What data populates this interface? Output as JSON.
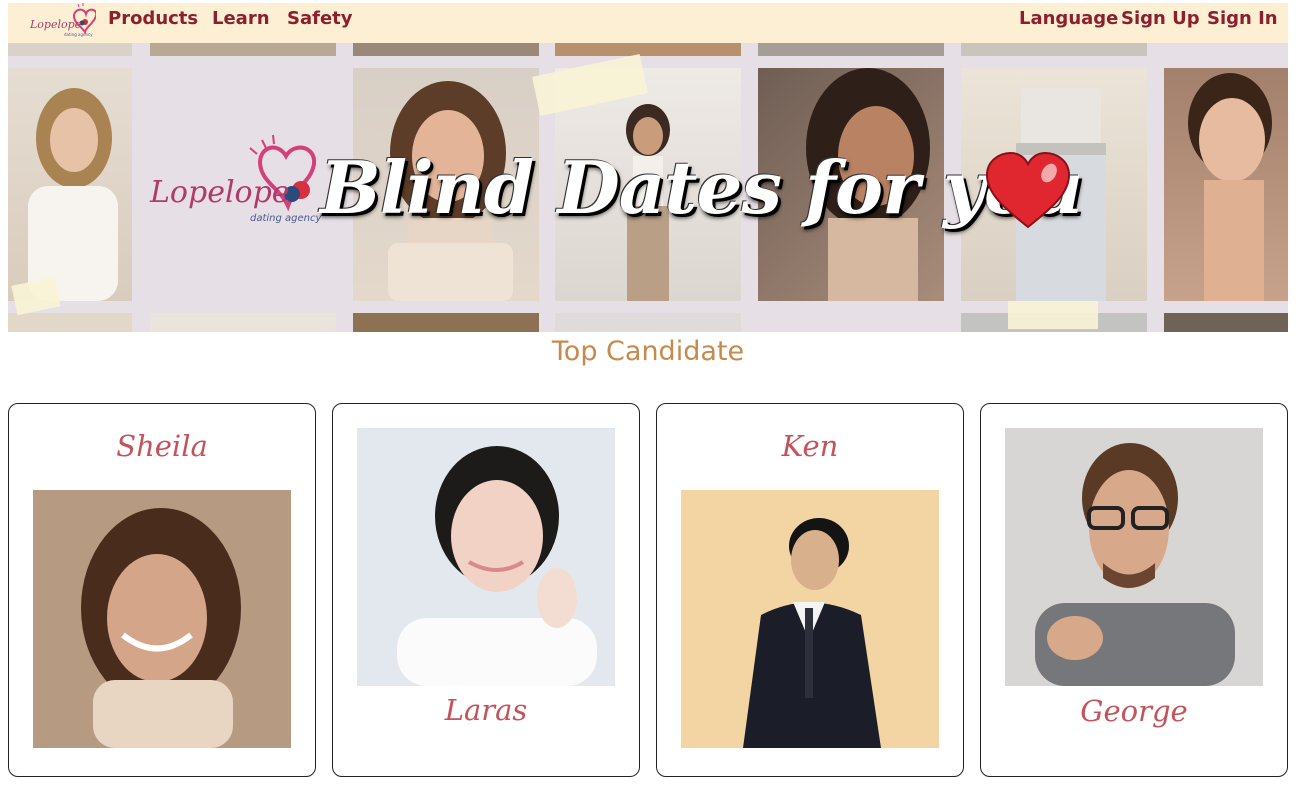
{
  "nav": {
    "logo": {
      "brand": "Lopelope",
      "tagline": "dating agency"
    },
    "left_links": [
      "Products",
      "Learn",
      "Safety"
    ],
    "right_links": [
      "Language",
      "Sign Up",
      "Sign In"
    ]
  },
  "hero": {
    "title": "Blind Dates for you",
    "logo": {
      "brand": "Lopelope",
      "tagline": "dating agency"
    },
    "heart_icon": "heart-icon"
  },
  "section": {
    "title": "Top Candidate"
  },
  "candidates": [
    {
      "name": "Sheila"
    },
    {
      "name": "Laras"
    },
    {
      "name": "Ken"
    },
    {
      "name": "George"
    }
  ],
  "colors": {
    "nav_bg": "#fdefd3",
    "nav_text": "#8b1f2d",
    "hero_bg": "#e7dfe6",
    "section_title": "#c58a4c",
    "candidate_name": "#c4525b"
  }
}
